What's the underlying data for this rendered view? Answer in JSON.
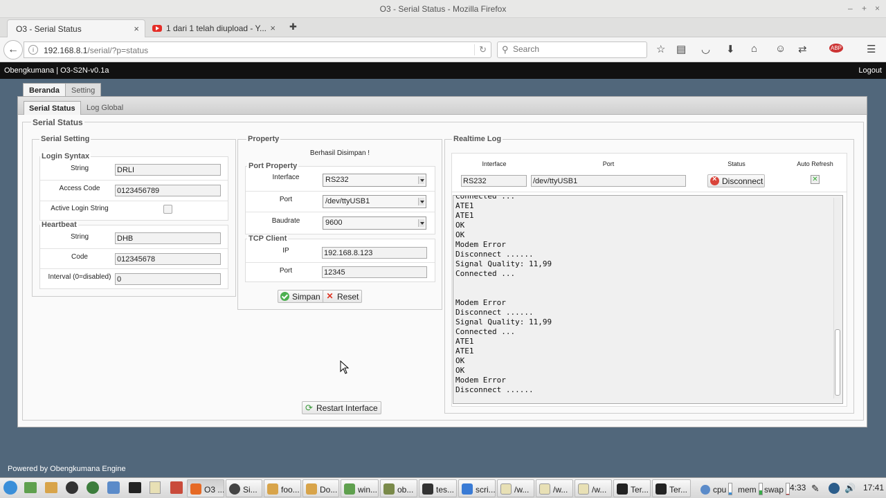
{
  "browser": {
    "window_title": "O3 - Serial Status - Mozilla Firefox",
    "win_controls": [
      "–",
      "+",
      "×"
    ],
    "tabs": [
      {
        "label": "O3 - Serial Status",
        "close": "×"
      },
      {
        "label": "1 dari 1 telah diupload - Y...",
        "close": "×"
      }
    ],
    "new_tab": "✚",
    "url_host": "192.168.8.1",
    "url_path": "/serial/?p=status",
    "search_placeholder": "Search"
  },
  "app": {
    "brand": "Obengkumana | O3-S2N-v0.1a",
    "logout": "Logout",
    "main_tabs": [
      "Beranda",
      "Setting"
    ],
    "sub_tabs": [
      "Serial Status",
      "Log Global"
    ],
    "section_title": "Serial Status",
    "footer": "Powered by Obengkumana Engine"
  },
  "serial_setting": {
    "title": "Serial Setting",
    "login_syntax": {
      "title": "Login Syntax",
      "string_label": "String",
      "string_value": "DRLI",
      "access_label": "Access Code",
      "access_value": "0123456789",
      "active_label": "Active Login String"
    },
    "heartbeat": {
      "title": "Heartbeat",
      "string_label": "String",
      "string_value": "DHB",
      "code_label": "Code",
      "code_value": "012345678",
      "interval_label": "Interval (0=disabled)",
      "interval_value": "0"
    }
  },
  "property": {
    "title": "Property",
    "message": "Berhasil Disimpan !",
    "port_property": {
      "title": "Port Property",
      "interface_label": "Interface",
      "interface_value": "RS232",
      "port_label": "Port",
      "port_value": "/dev/ttyUSB1",
      "baud_label": "Baudrate",
      "baud_value": "9600"
    },
    "tcp_client": {
      "title": "TCP Client",
      "ip_label": "IP",
      "ip_value": "192.168.8.123",
      "port_label": "Port",
      "port_value": "12345"
    },
    "save_label": "Simpan",
    "reset_label": "Reset",
    "restart_label": "Restart Interface"
  },
  "realtime_log": {
    "title": "Realtime Log",
    "col_interface": "Interface",
    "col_port": "Port",
    "col_status": "Status",
    "col_auto": "Auto Refresh",
    "interface_value": "RS232",
    "port_value": "/dev/ttyUSB1",
    "disconnect_label": "Disconnect",
    "log_text": "Connected ...\nATE1\nATE1\nOK\nOK\nModem Error\nDisconnect ......\nSignal Quality: 11,99\nConnected ...\n\n\nModem Error\nDisconnect ......\nSignal Quality: 11,99\nConnected ...\nATE1\nATE1\nOK\nOK\nModem Error\nDisconnect ......"
  },
  "taskbar": {
    "items": [
      "O3 ...",
      "Si...",
      "foo...",
      "Do...",
      "win...",
      "ob...",
      "tes...",
      "scri...",
      "/w...",
      "/w...",
      "/w...",
      "Ter...",
      "Ter..."
    ],
    "cpu": "cpu",
    "mem": "mem",
    "swap": "swap",
    "uptime": "4:33",
    "clock": "17:41"
  },
  "colors": {
    "header_bg": "#111111",
    "page_bg": "#51677b",
    "ok_green": "#4caf50",
    "error_red": "#d9443a"
  }
}
